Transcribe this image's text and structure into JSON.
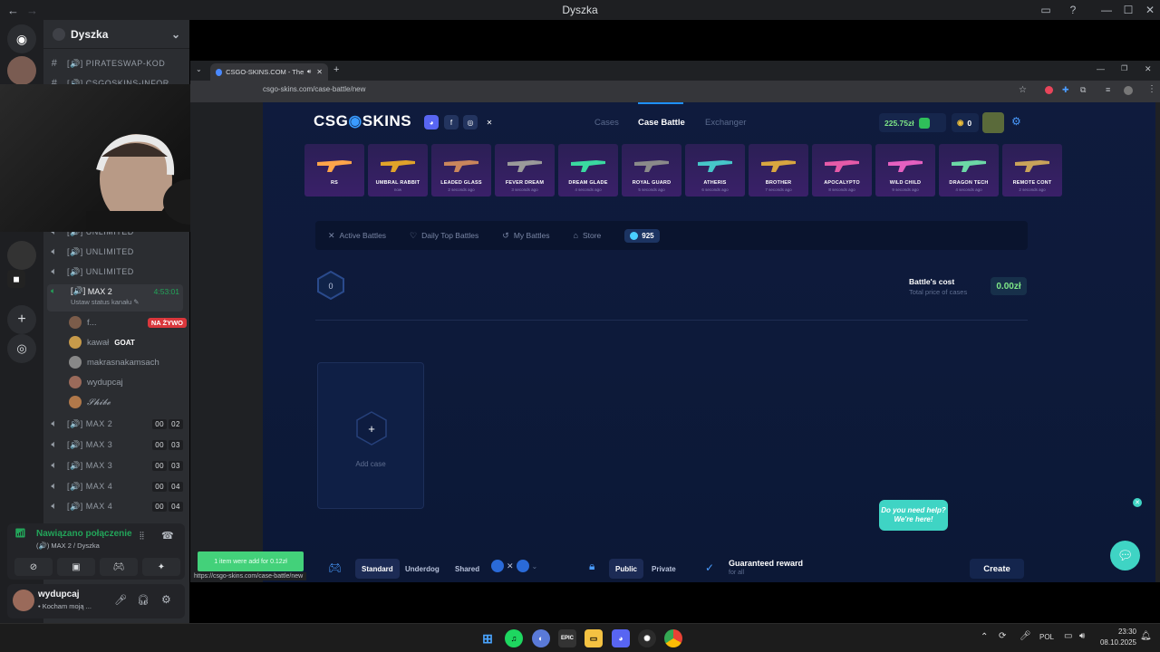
{
  "window": {
    "title": "Dyszka"
  },
  "server": {
    "name": "Dyszka"
  },
  "channels": {
    "top": [
      "[🔊] PIRATESWAP-KOD",
      "[🔊] CSGOSKINS-INFOR"
    ],
    "voice": [
      {
        "label": "UNLIMITED"
      },
      {
        "label": "UNLIMITED"
      },
      {
        "label": "UNLIMITED"
      },
      {
        "label": "UNLIMITED"
      }
    ],
    "active": {
      "label": "MAX 2",
      "time": "4:53:01",
      "status": "Ustaw status kanału"
    },
    "members": [
      {
        "name": "f...",
        "badge": "NA ŻYWO"
      },
      {
        "name": "kawał",
        "badge": "GOAT"
      },
      {
        "name": "makrasnakamsach",
        "badge": ""
      },
      {
        "name": "wydupcaj",
        "badge": ""
      },
      {
        "name": "𝓢𝓱𝓲𝓫𝓮",
        "badge": ""
      }
    ],
    "more": [
      {
        "label": "MAX 2",
        "a": "00",
        "b": "02"
      },
      {
        "label": "MAX 3",
        "a": "00",
        "b": "03"
      },
      {
        "label": "MAX 3",
        "a": "00",
        "b": "03"
      },
      {
        "label": "MAX 4",
        "a": "00",
        "b": "04"
      },
      {
        "label": "MAX 4",
        "a": "00",
        "b": "04"
      }
    ]
  },
  "voice_panel": {
    "status": "Nawiązano połączenie",
    "channel": "MAX 2 / Dyszka"
  },
  "user_panel": {
    "name": "wydupcaj",
    "status": "• Kocham moją ..."
  },
  "browser": {
    "tab_title": "CSGO-SKINS.COM - The be",
    "url": "csgo-skins.com/case-battle/new",
    "status_url": "https://csgo-skins.com/case-battle/new"
  },
  "site": {
    "logo_left": "CSG",
    "logo_right": "SKINS",
    "nav": [
      "Cases",
      "Case Battle",
      "Exchanger"
    ],
    "balance": "225.75zł",
    "coins_small": "0",
    "drops": [
      {
        "name": "RS",
        "when": "",
        "color": "#ffa54a"
      },
      {
        "name": "UMBRAL RABBIT",
        "when": "now",
        "color": "#e0a32a"
      },
      {
        "name": "LEADED GLASS",
        "when": "2 seconds ago",
        "color": "#c9865c"
      },
      {
        "name": "FEVER DREAM",
        "when": "3 seconds ago",
        "color": "#9a9a9a"
      },
      {
        "name": "DREAM GLADE",
        "when": "4 seconds ago",
        "color": "#3ad9a0"
      },
      {
        "name": "ROYAL GUARD",
        "when": "5 seconds ago",
        "color": "#8a8a8a"
      },
      {
        "name": "ATHERIS",
        "when": "6 seconds ago",
        "color": "#46c6c9"
      },
      {
        "name": "BROTHER",
        "when": "7 seconds ago",
        "color": "#d8a640"
      },
      {
        "name": "APOCALYPTO",
        "when": "8 seconds ago",
        "color": "#e55aa8"
      },
      {
        "name": "WILD CHILD",
        "when": "9 seconds ago",
        "color": "#e560c0"
      },
      {
        "name": "DRAGON TECH",
        "when": "4 seconds ago",
        "color": "#6cd8a6"
      },
      {
        "name": "REMOTE CONT",
        "when": "2 seconds ago",
        "color": "#c9a35a"
      }
    ],
    "tabs": [
      "Active Battles",
      "Daily Top Battles",
      "My Battles",
      "Store"
    ],
    "coins": "925",
    "rounds": "0",
    "cost_label": "Battle's cost",
    "cost_sub": "Total price of cases",
    "cost_value": "0.00zł",
    "add_case": "Add case",
    "modes": [
      "Standard",
      "Underdog",
      "Shared"
    ],
    "visibility": [
      "Public",
      "Private"
    ],
    "reward_title": "Guaranteed reward",
    "reward_sub": "for all",
    "create": "Create",
    "help": "Do you need help? We're here!",
    "toast": "1 item were add for 0.12zł"
  },
  "taskbar": {
    "lang": "POL",
    "time": "23:30",
    "date": "08.10.2025"
  }
}
